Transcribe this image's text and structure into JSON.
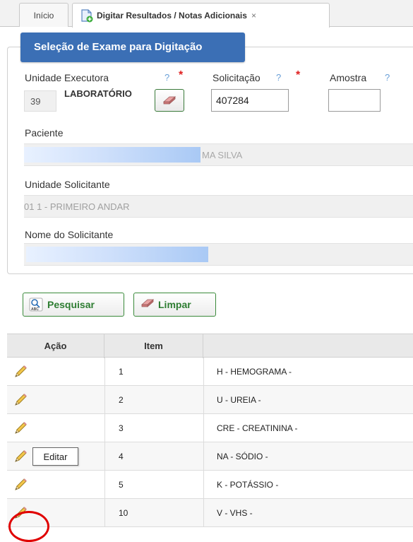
{
  "tabs": {
    "home_label": "Início",
    "active_label": "Digitar Resultados / Notas Adicionais",
    "close_symbol": "×"
  },
  "panel": {
    "title": "Seleção de Exame para Digitação"
  },
  "form": {
    "unidade_executora": {
      "label": "Unidade Executora",
      "help": "?",
      "required": "*",
      "code": "39",
      "name": "LABORATÓRIO"
    },
    "solicitacao": {
      "label": "Solicitação",
      "help": "?",
      "required": "*",
      "value": "407284"
    },
    "amostra": {
      "label": "Amostra",
      "help": "?",
      "value": ""
    },
    "paciente": {
      "label": "Paciente",
      "value_suffix": "MA SILVA"
    },
    "unidade_solicitante": {
      "label": "Unidade Solicitante",
      "value": "01 1 - PRIMEIRO ANDAR"
    },
    "nome_solicitante": {
      "label": "Nome do Solicitante"
    }
  },
  "actions": {
    "search_label": "Pesquisar",
    "clear_label": "Limpar"
  },
  "table": {
    "headers": [
      "Ação",
      "Item",
      ""
    ],
    "rows": [
      {
        "item": "1",
        "exam": "H - HEMOGRAMA -"
      },
      {
        "item": "2",
        "exam": "U - UREIA -"
      },
      {
        "item": "3",
        "exam": "CRE - CREATININA -"
      },
      {
        "item": "4",
        "exam": "NA - SÓDIO -"
      },
      {
        "item": "5",
        "exam": "K - POTÁSSIO -"
      },
      {
        "item": "10",
        "exam": "V - VHS -"
      }
    ]
  },
  "tooltip": {
    "text": "Editar"
  },
  "colors": {
    "panel_title_bg": "#3b6fb5",
    "button_text": "#2e7d32",
    "required": "#e02020",
    "help": "#6aa0d8",
    "highlight_circle": "#e00000"
  }
}
